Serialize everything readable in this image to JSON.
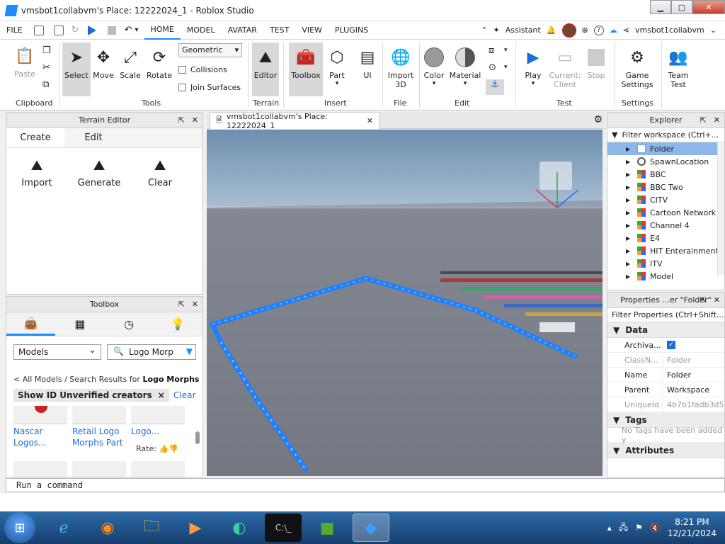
{
  "window": {
    "title": "vmsbot1collabvm's Place: 12222024_1 - Roblox Studio"
  },
  "menu": {
    "file": "FILE",
    "tabs": [
      "HOME",
      "MODEL",
      "AVATAR",
      "TEST",
      "VIEW",
      "PLUGINS"
    ],
    "assistant": "Assistant",
    "username": "vmsbot1collabvm"
  },
  "ribbon": {
    "clipboard": {
      "paste": "Paste",
      "group": "Clipboard"
    },
    "tools": {
      "select": "Select",
      "move": "Move",
      "scale": "Scale",
      "rotate": "Rotate",
      "mode": "Geometric",
      "collisions": "Collisions",
      "join": "Join Surfaces",
      "group": "Tools"
    },
    "terrain": {
      "editor": "Editor",
      "group": "Terrain"
    },
    "insert": {
      "toolbox": "Toolbox",
      "part": "Part",
      "ui": "UI",
      "group": "Insert"
    },
    "file": {
      "import1": "Import",
      "import2": "3D",
      "group": "File"
    },
    "edit": {
      "color": "Color",
      "material": "Material",
      "group": "Edit"
    },
    "test": {
      "play": "Play",
      "client1": "Current:",
      "client2": "Client",
      "stop": "Stop",
      "group": "Test"
    },
    "settings": {
      "game1": "Game",
      "game2": "Settings",
      "group": "Settings"
    },
    "team": {
      "l1": "Team",
      "l2": "Test"
    }
  },
  "terrain_editor": {
    "title": "Terrain Editor",
    "tabs": [
      "Create",
      "Edit"
    ],
    "tools": [
      "Import",
      "Generate",
      "Clear"
    ]
  },
  "toolbox": {
    "title": "Toolbox",
    "category": "Models",
    "search": "Logo Morp",
    "breadcrumb_prefix": "< All Models / Search Results for ",
    "breadcrumb_query": "Logo Morphs",
    "chip": "Show ID Unverified creators",
    "clear": "Clear",
    "assets": [
      {
        "l1": "Nascar",
        "l2": "Logos..."
      },
      {
        "l1": "Retail Logo",
        "l2": "Morphs Part"
      },
      {
        "l1": "Logo...",
        "l2": ""
      }
    ],
    "rate": "Rate:"
  },
  "viewport": {
    "tab": "vmsbot1collabvm's Place: 12222024_1"
  },
  "explorer": {
    "title": "Explorer",
    "filter": "Filter workspace (Ctrl+...",
    "items": [
      {
        "label": "Folder",
        "icon": "folder"
      },
      {
        "label": "SpawnLocation",
        "icon": "gear"
      },
      {
        "label": "BBC",
        "icon": "model"
      },
      {
        "label": "BBC Two",
        "icon": "model"
      },
      {
        "label": "CITV",
        "icon": "model"
      },
      {
        "label": "Cartoon Network",
        "icon": "model"
      },
      {
        "label": "Channel 4",
        "icon": "model"
      },
      {
        "label": "E4",
        "icon": "model"
      },
      {
        "label": "HIT Enterainment",
        "icon": "model"
      },
      {
        "label": "ITV",
        "icon": "model"
      },
      {
        "label": "Model",
        "icon": "model"
      }
    ]
  },
  "properties": {
    "title": "Properties ...er \"Folder\"",
    "filter": "Filter Properties (Ctrl+Shift...",
    "sections": {
      "data": "Data",
      "tags": "Tags",
      "attributes": "Attributes"
    },
    "rows": [
      {
        "k": "Archiva...",
        "v": ""
      },
      {
        "k": "ClassN...",
        "v": "Folder"
      },
      {
        "k": "Name",
        "v": "Folder"
      },
      {
        "k": "Parent",
        "v": "Workspace"
      },
      {
        "k": "UniqueId",
        "v": "4b7b1fadb3d5"
      }
    ],
    "no_tags": "No Tags have been added y"
  },
  "command": {
    "placeholder": "Run a command"
  },
  "taskbar": {
    "time": "8:21 PM",
    "date": "12/21/2024"
  },
  "colors": {
    "accent": "#1a8cff",
    "taskbar": "#1d4d85",
    "selection": "#8fb6e8"
  }
}
